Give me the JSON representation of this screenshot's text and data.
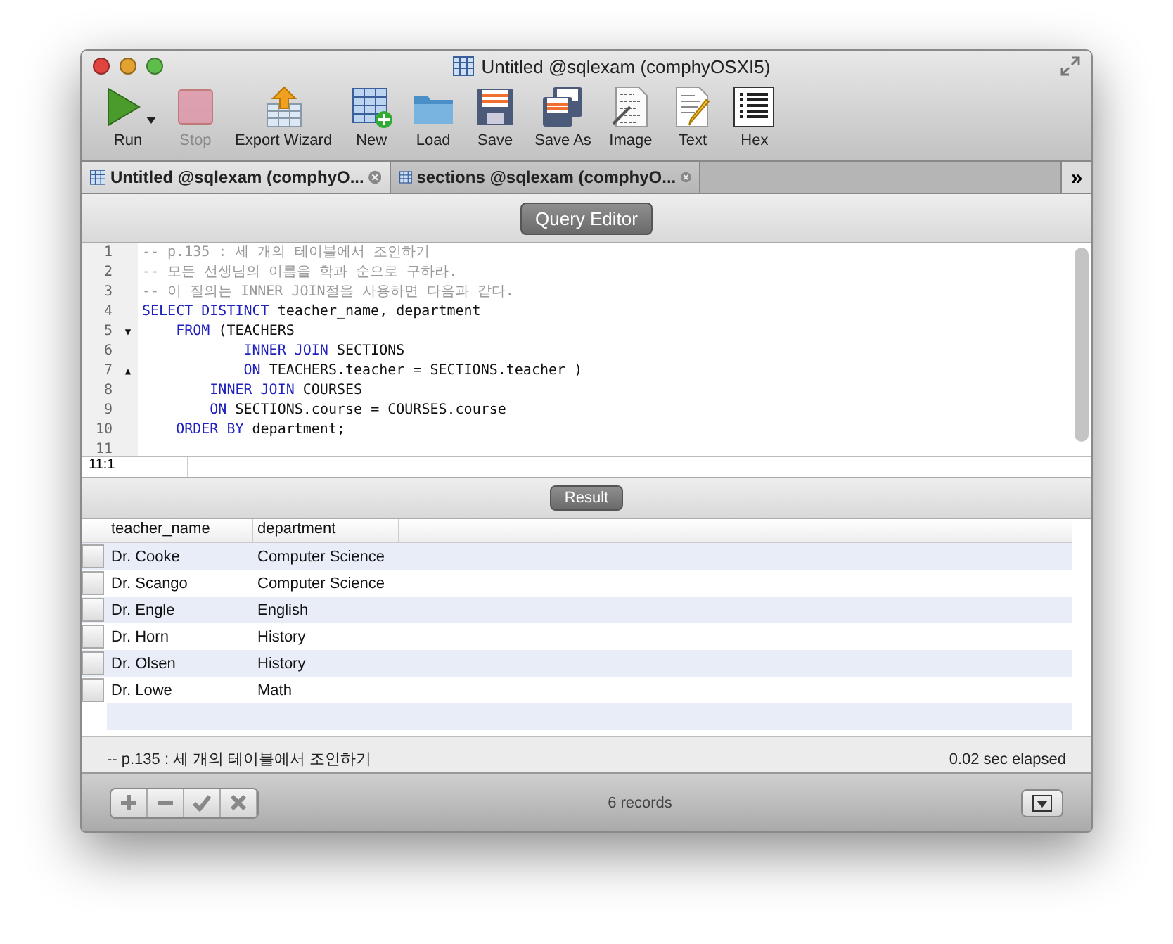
{
  "window": {
    "title": "Untitled @sqlexam (comphyOSXI5)"
  },
  "toolbar": [
    {
      "kind": "run",
      "label": "Run",
      "disabled": false,
      "menu": true
    },
    {
      "kind": "stop",
      "label": "Stop",
      "disabled": true,
      "menu": false
    },
    {
      "kind": "export",
      "label": "Export Wizard",
      "disabled": false,
      "menu": false
    },
    {
      "kind": "new",
      "label": "New",
      "disabled": false,
      "menu": false
    },
    {
      "kind": "load",
      "label": "Load",
      "disabled": false,
      "menu": false
    },
    {
      "kind": "save",
      "label": "Save",
      "disabled": false,
      "menu": false
    },
    {
      "kind": "saveas",
      "label": "Save As",
      "disabled": false,
      "menu": false
    },
    {
      "kind": "image",
      "label": "Image",
      "disabled": false,
      "menu": false
    },
    {
      "kind": "text",
      "label": "Text",
      "disabled": false,
      "menu": false
    },
    {
      "kind": "hex",
      "label": "Hex",
      "disabled": false,
      "menu": false
    }
  ],
  "tabs": [
    {
      "label": "Untitled @sqlexam (comphyO...",
      "selected": true
    },
    {
      "label": "sections @sqlexam (comphyO...",
      "selected": false
    }
  ],
  "overflow": "»",
  "editor": {
    "button": "Query Editor",
    "lines": [
      {
        "number": "1",
        "tokens": [
          {
            "kind": "comment",
            "text": "-- p.135 : 세 개의 테이블에서 조인하기"
          }
        ]
      },
      {
        "number": "2",
        "tokens": [
          {
            "kind": "comment",
            "text": "-- 모든 선생님의 이름을 학과 순으로 구하라."
          }
        ]
      },
      {
        "number": "3",
        "tokens": [
          {
            "kind": "comment",
            "text": "-- 이 질의는 INNER JOIN절을 사용하면 다음과 같다."
          }
        ]
      },
      {
        "number": "4",
        "tokens": [
          {
            "kind": "keyword",
            "text": "SELECT DISTINCT"
          },
          {
            "kind": "plain",
            "text": " teacher_name, department"
          }
        ]
      },
      {
        "number": "5",
        "fold_marker": "▼",
        "tokens": [
          {
            "kind": "keyword",
            "text": "    FROM"
          },
          {
            "kind": "plain",
            "text": " (TEACHERS"
          }
        ]
      },
      {
        "number": "6",
        "tokens": [
          {
            "kind": "keyword",
            "text": "            INNER JOIN"
          },
          {
            "kind": "plain",
            "text": " SECTIONS"
          }
        ]
      },
      {
        "number": "7",
        "fold_marker": "▲",
        "tokens": [
          {
            "kind": "keyword",
            "text": "            ON"
          },
          {
            "kind": "plain",
            "text": " TEACHERS.teacher = SECTIONS.teacher )"
          }
        ]
      },
      {
        "number": "8",
        "tokens": [
          {
            "kind": "keyword",
            "text": "        INNER JOIN"
          },
          {
            "kind": "plain",
            "text": " COURSES"
          }
        ]
      },
      {
        "number": "9",
        "tokens": [
          {
            "kind": "keyword",
            "text": "        ON"
          },
          {
            "kind": "plain",
            "text": " SECTIONS.course = COURSES.course"
          }
        ]
      },
      {
        "number": "10",
        "tokens": [
          {
            "kind": "keyword",
            "text": "    ORDER BY"
          },
          {
            "kind": "plain",
            "text": " department;"
          }
        ]
      },
      {
        "number": "11"
      }
    ],
    "position": "11:1"
  },
  "result": {
    "button": "Result",
    "columns": [
      "teacher_name",
      "department"
    ],
    "rows": [
      [
        "Dr. Cooke",
        "Computer Science"
      ],
      [
        "Dr. Scango",
        "Computer Science"
      ],
      [
        "Dr. Engle",
        "English"
      ],
      [
        "Dr. Horn",
        "History"
      ],
      [
        "Dr. Olsen",
        "History"
      ],
      [
        "Dr. Lowe",
        "Math"
      ]
    ]
  },
  "status": {
    "message": "-- p.135 : 세 개의 테이블에서 조인하기",
    "elapsed": "0.02 sec elapsed"
  },
  "bottom_bar": {
    "records": "6 records"
  }
}
